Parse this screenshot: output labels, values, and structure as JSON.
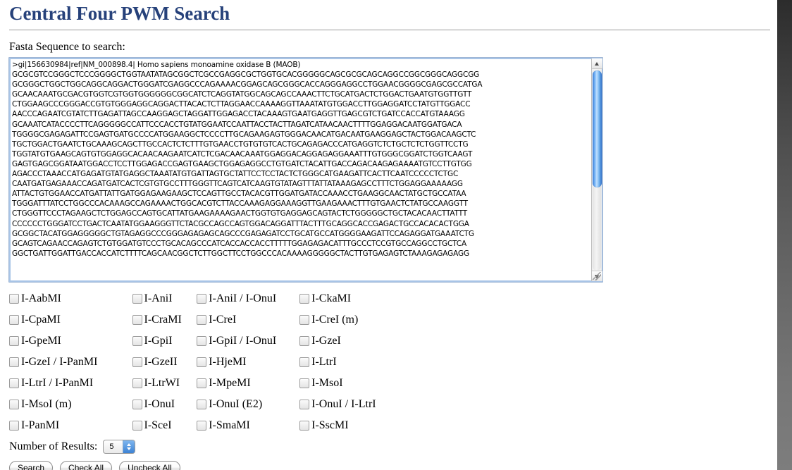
{
  "page": {
    "title": "Central Four PWM Search",
    "fasta_label": "Fasta Sequence to search:"
  },
  "textarea": {
    "name": "fasta-sequence-input",
    "value": ">gi|156630984|ref|NM_000898.4| Homo sapiens monoamine oxidase B (MAOB)\nGCGCGTCCGGGCTCCCGGGGCTGGTAATATAGCGGCTCGCCGAGGCGCTGGTGCACGGGGGCAGCGCGCAGCAGGCCGGCGGGCAGGCGG\nGCGGGCTGGCTGGCAGGCAGGACTGGGATCGAGGCCCAGAAAACGGAGCAGCGGGCACCAGGGAGGCCTGGAACGGGGCGAGCGCCATGA\nGCAACAAATGCGACGTGGTCGTGGTGGGGGGCGGCATCTCAGGTATGGCAGCAGCCAAACTTCTGCATGACTCTGGACTGAATGTGGTTGTT\nCTGGAAGCCCGGGACCGTGTGGGAGGCAGGACTTACACTCTTAGGAACCAAAAGGTTAAATATGTGGACCTTGGAGGATCCTATGTTGGACC\nAACCCAGAATCGTATCTTGAGATTAGCCAAGGAGCTAGGATTGGAGACCTACAAAGTGAATGAGGTTGAGCGTCTGATCCACCATGTAAAGG\nGCAAATCATACCCCTTCAGGGGGCCATTCCCACCTGTATGGAATCCAATTACCTACTTAGATCATAACAACTTTTGGAGGACAATGGATGACA\nTGGGGCGAGAGATTCCGAGTGATGCCCCATGGAAGGCTCCCCTTGCAGAAGAGTGGGACAACATGACAATGAAGGAGCTACTGGACAAGCTC\nTGCTGGACTGAATCTGCAAAGCAGCTTGCCACTCTCTTTGTGAACCTGTGTGTCACTGCAGAGACCCATGAGGTCTCTGCTCTCTGGTTCCTG\nTGGTATGTGAAGCAGTGTGGAGGCACAACAAGAATCATCTCGACAACAAATGGAGGACAGGAGAGGAAATTTGTGGGCGGATCTGGTCAAGT\nGAGTGAGCGGATAATGGACCTCCTTGGAGACCGAGTGAAGCTGGAGAGGCCTGTGATCTACATTGACCAGACAAGAGAAAATGTCCTTGTGG\nAGACCCTAAACCATGAGATGTATGAGGCTAAATATGTGATTAGTGCTATTCCTCCTACTCTGGGCATGAAGATTCACTTCAATCCCCCTCTGC\nCAATGATGAGAAACCAGATGATCACTCGTGTGCCTTTGGGTTCAGTCATCAAGTGTATAGTTTATTATAAAGAGCCTTTCTGGAGGAAAAAGG\nATTACTGTGGAACCATGATTATTGATGGAGAAGAAGCTCCAGTTGCCTACACGTTGGATGATACCAAACCTGAAGGCAACTATGCTGCCATAA\nTGGGATTTATCCTGGCCCACAAAGCCAGAAAACTGGCACGTCTTACCAAAGAGGAAAGGTTGAAGAAACTTTGTGAACTCTATGCCAAGGTT\nCTGGGTTCCCTAGAAGCTCTGGAGCCAGTGCATTATGAAGAAAAGAACTGGTGTGAGGAGCAGTACTCTGGGGGCTGCTACACAACTTATTT\nCCCCCCTGGGATCCTGACTCAATATGGAAGGGTTCTACGCCAGCCAGTGGACAGGATTTACTTTGCAGGCACCGAGACTGCCACACACTGGA\nGCGGCTACATGGAGGGGGCTGTAGAGGCCCGGGAGAGAGCAGCCCGAGAGATCCTGCATGCCATGGGGAAGATTCCAGAGGATGAAATCTG\nGCAGTCAGAACCAGAGTCTGTGGATGTCCCTGCACAGCCCATCACCACCACCTTTTTGGAGAGACATTTGCCCTCCGTGCCAGGCCTGCTCA\nGGCTGATTGGATTGACCACCATCTTTTCAGCAACGGCTCTTGGCTTCCTGGCCCACAAAAGGGGGCTACTTGTGAGAGTCTAAAGAGAGAGG"
  },
  "scrollbar": {
    "up_arrow": "scroll-up-arrow",
    "down_arrow": "scroll-down-arrow"
  },
  "checkboxes": {
    "rows": [
      [
        {
          "label": "I-AabMI",
          "checked": false
        },
        {
          "label": "I-AniI",
          "checked": false
        },
        {
          "label": "I-AniI / I-OnuI",
          "checked": false
        },
        {
          "label": "I-CkaMI",
          "checked": false
        }
      ],
      [
        {
          "label": "I-CpaMI",
          "checked": false
        },
        {
          "label": "I-CraMI",
          "checked": false
        },
        {
          "label": "I-CreI",
          "checked": false
        },
        {
          "label": "I-CreI (m)",
          "checked": false
        }
      ],
      [
        {
          "label": "I-GpeMI",
          "checked": false
        },
        {
          "label": "I-GpiI",
          "checked": false
        },
        {
          "label": "I-GpiI / I-OnuI",
          "checked": false
        },
        {
          "label": "I-GzeI",
          "checked": false
        }
      ],
      [
        {
          "label": "I-GzeI / I-PanMI",
          "checked": false
        },
        {
          "label": "I-GzeII",
          "checked": false
        },
        {
          "label": "I-HjeMI",
          "checked": false
        },
        {
          "label": "I-LtrI",
          "checked": false
        }
      ],
      [
        {
          "label": "I-LtrI / I-PanMI",
          "checked": false
        },
        {
          "label": "I-LtrWI",
          "checked": false
        },
        {
          "label": "I-MpeMI",
          "checked": false
        },
        {
          "label": "I-MsoI",
          "checked": false
        }
      ],
      [
        {
          "label": "I-MsoI (m)",
          "checked": false
        },
        {
          "label": "I-OnuI",
          "checked": false
        },
        {
          "label": "I-OnuI (E2)",
          "checked": false
        },
        {
          "label": "I-OnuI / I-LtrI",
          "checked": false
        }
      ],
      [
        {
          "label": "I-PanMI",
          "checked": false
        },
        {
          "label": "I-SceI",
          "checked": false
        },
        {
          "label": "I-SmaMI",
          "checked": false
        },
        {
          "label": "I-SscMI",
          "checked": false
        }
      ]
    ]
  },
  "results": {
    "label": "Number of Results:",
    "selected": "5",
    "options": [
      "5"
    ]
  },
  "buttons": {
    "search": "Search",
    "check_all": "Check All",
    "uncheck_all": "Uncheck All"
  }
}
